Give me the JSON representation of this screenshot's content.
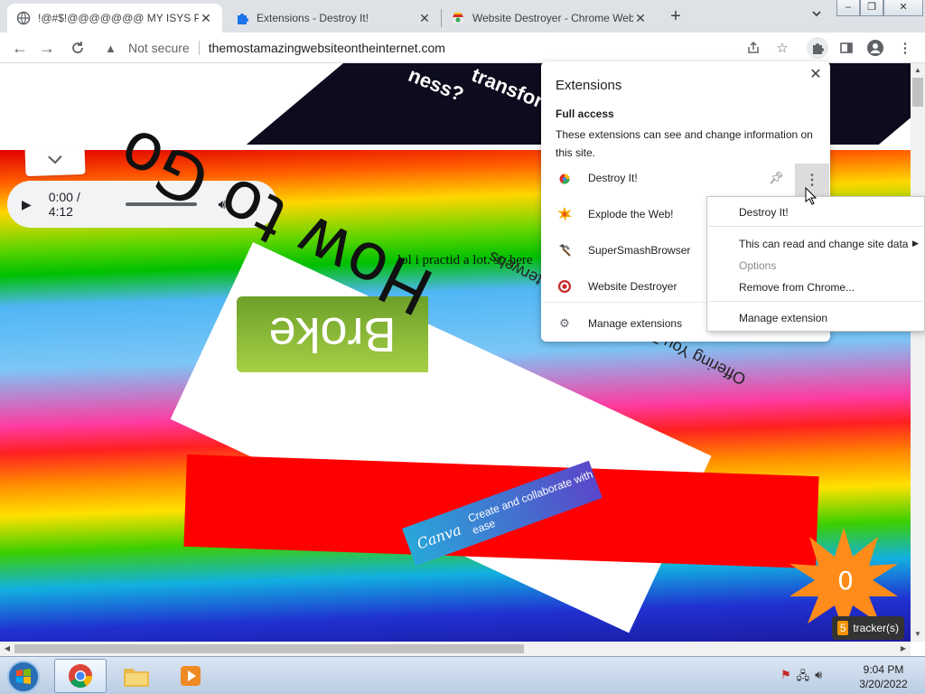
{
  "tabs": [
    {
      "title": "!@#$!@@@@@@@ MY ISYS PR",
      "icon": "globe-icon",
      "active": true
    },
    {
      "title": "Extensions - Destroy It!",
      "icon": "puzzle-piece-icon",
      "active": false
    },
    {
      "title": "Website Destroyer - Chrome Web",
      "icon": "chrome-web-store-icon",
      "active": false
    }
  ],
  "toolbar": {
    "security_label": "Not secure",
    "url": "themostamazingwebsiteontheinternet.com"
  },
  "page": {
    "banner_word_1": "ness?",
    "banner_word_2": "transfor",
    "audio": {
      "time": "0:00 / 4:12"
    },
    "lol_text": "lol i practid a lot. so here",
    "how_to": "How to Go",
    "tagline": "Offering You The Best of The Interwebs",
    "tag_text": "Broke",
    "canva": {
      "logo": "Canva",
      "line1": "Create and",
      "line2": "collaborate",
      "line3": "with ease"
    },
    "counter": "0",
    "trackers": {
      "count": "5",
      "label": "tracker(s)"
    }
  },
  "extensions_popup": {
    "title": "Extensions",
    "section": "Full access",
    "description": "These extensions can see and change information on this site.",
    "items": [
      {
        "name": "Destroy It!",
        "icon": "destroy-it-icon"
      },
      {
        "name": "Explode the Web!",
        "icon": "explosion-icon"
      },
      {
        "name": "SuperSmashBrowser",
        "icon": "hammer-icon"
      },
      {
        "name": "Website Destroyer",
        "icon": "target-icon"
      }
    ],
    "manage": "Manage extensions"
  },
  "context_menu": {
    "items": [
      {
        "label": "Destroy It!",
        "disabled": false
      },
      {
        "label": "This can read and change site data",
        "disabled": false,
        "submenu": true
      },
      {
        "label": "Options",
        "disabled": true
      },
      {
        "label": "Remove from Chrome...",
        "disabled": false
      },
      {
        "label": "Manage extension",
        "disabled": false
      }
    ]
  },
  "taskbar": {
    "time": "9:04 PM",
    "date": "3/20/2022"
  },
  "colors": {
    "chrome_frame": "#dee1e6",
    "context_highlight": "#dcdcdc",
    "red_banner": "#ff0000",
    "starburst": "#ff8c1a"
  }
}
